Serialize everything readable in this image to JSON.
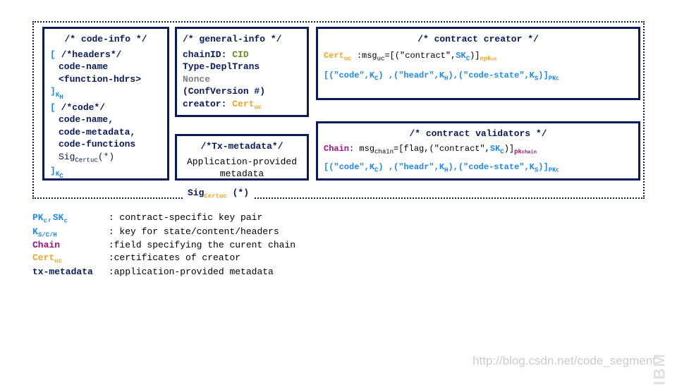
{
  "codeInfo": {
    "title": "/* code-info */",
    "headers_open": "[",
    "headers_comment": "/*headers*/",
    "code_name1": "code-name",
    "func_hdrs": "<function-hdrs>",
    "headers_close": "]",
    "headers_sub": "K",
    "headers_sub2": "H",
    "code_open": "[",
    "code_comment": "/*code*/",
    "code_name2": "code-name,",
    "code_metadata": "code-metadata,",
    "code_functions": "code-functions",
    "sig": "Sig",
    "sig_sub": "Certuc",
    "sig_star": "(*)",
    "code_close": "]",
    "code_sub": "K",
    "code_sub2": "C"
  },
  "generalInfo": {
    "title": "/* general-info */",
    "chainId_label": "chainID: ",
    "chainId_val": "CID",
    "type": "Type-DeplTrans",
    "nonce": "Nonce",
    "conf": "(ConfVersion #)",
    "creator_label": "creator: ",
    "creator_val": "Cert",
    "creator_sub": "uc"
  },
  "txMeta": {
    "title": "/*Tx-metadata*/",
    "body": "Application-provided metadata"
  },
  "creator": {
    "title": "/* contract creator */",
    "cert": "Cert",
    "cert_sub": "uc",
    "msg_prefix": " :msg",
    "msg_sub": "uc",
    "msg_eq": "=[(\"contract\",",
    "skc": "SK",
    "skc_sub": "C",
    "msg_close": ")]",
    "epk": "epk",
    "epk_sub": "uc",
    "line2_open": "[(\"code\",",
    "kc": "K",
    "kc_sub": "C",
    "line2_mid1": ") ,(\"headr\",",
    "kh": "K",
    "kh_sub": "H",
    "line2_mid2": "),(\"code-state\",",
    "ks": "K",
    "ks_sub": "S",
    "line2_close": ")]",
    "pkc": "PK",
    "pkc_sub": "C"
  },
  "validators": {
    "title": "/* contract validators */",
    "chain": "Chain",
    "msg_prefix": ": msg",
    "msg_sub": "chain",
    "msg_eq": "=[flag,(\"contract\",",
    "skc": "SK",
    "skc_sub": "C",
    "msg_close": ")]",
    "pk": "pk",
    "pk_sub": "chain",
    "line2_open": "[(\"code\",",
    "kc": "K",
    "kc_sub": "C",
    "line2_mid1": ") ,(\"headr\",",
    "kh": "K",
    "kh_sub": "H",
    "line2_mid2": "),(\"code-state\",",
    "ks": "K",
    "ks_sub": "S",
    "line2_close": ")]",
    "pkc": "PK",
    "pkc_sub": "C"
  },
  "sigLabel": {
    "sig": "Sig",
    "sub": "Certuc",
    "star": " (*)"
  },
  "legend": {
    "pkc": "PK",
    "pkc_s": "c",
    "skc": "SK",
    "skc_s": "c",
    "pkc_desc": ": contract-specific key pair",
    "k": "K",
    "k_s": "S/C/H",
    "k_desc": ": key for state/content/headers",
    "chain": "Chain",
    "chain_desc": ":field specifying the curent chain",
    "cert": "Cert",
    "cert_s": "uc",
    "cert_desc": ":certificates of creator",
    "tx": "tx-metadata",
    "tx_desc": ":application-provided metadata"
  },
  "watermark": {
    "url": "http://blog.csdn.net/code_segment",
    "ibm": "IBM"
  }
}
